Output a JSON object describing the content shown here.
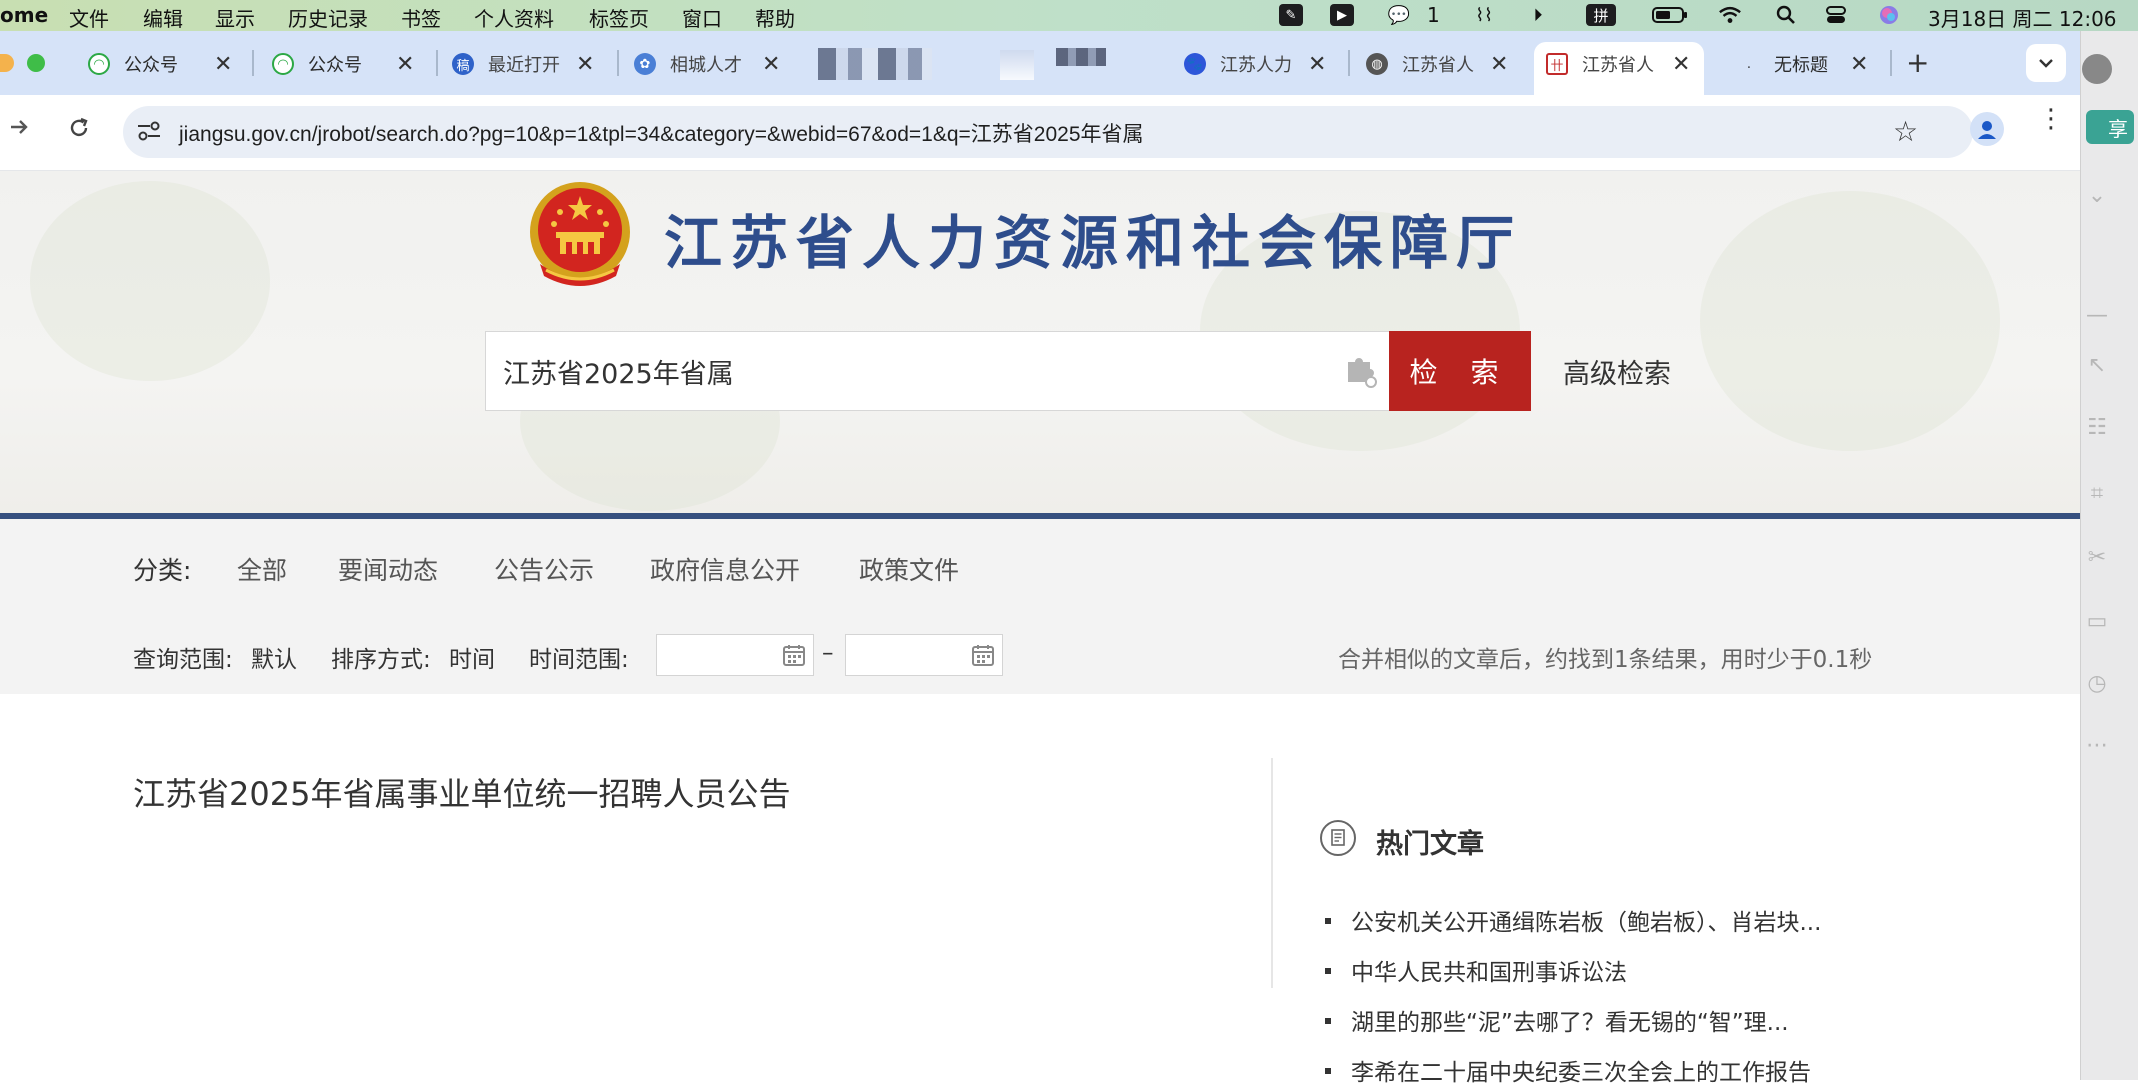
{
  "menubar": {
    "app_name": "ome",
    "items": [
      "文件",
      "编辑",
      "显示",
      "历史记录",
      "书签",
      "个人资料",
      "标签页",
      "窗口",
      "帮助"
    ],
    "wechat_count": "1",
    "ime_label": "拼",
    "datetime": "3月18日 周二  12:06"
  },
  "tabs": [
    {
      "title": "公众号",
      "icon": "wechat-mp-icon"
    },
    {
      "title": "公众号",
      "icon": "wechat-mp-icon"
    },
    {
      "title": "最近打开",
      "icon": "doc-app-icon"
    },
    {
      "title": "相城人才",
      "icon": "xiangcheng-icon"
    },
    {
      "title": "",
      "icon": "blurred-icon"
    },
    {
      "title": "",
      "icon": "blurred-icon"
    },
    {
      "title": "",
      "icon": "blurred-icon"
    },
    {
      "title": "江苏人力",
      "icon": "baidu-icon"
    },
    {
      "title": "江苏省人",
      "icon": "globe-icon"
    },
    {
      "title": "江苏省人",
      "icon": "jiangsu-gov-icon",
      "active": true
    },
    {
      "title": "无标题",
      "icon": "blank-icon"
    }
  ],
  "address": {
    "url": "jiangsu.gov.cn/jrobot/search.do?pg=10&p=1&tpl=34&category=&webid=67&od=1&q=江苏省2025年省属"
  },
  "header": {
    "site_title": "江苏省人力资源和社会保障厅",
    "search_value": "江苏省2025年省属",
    "search_button": "检 索",
    "advanced_search": "高级检索"
  },
  "filters": {
    "category_label": "分类:",
    "categories": [
      "全部",
      "要闻动态",
      "公告公示",
      "政府信息公开",
      "政策文件"
    ],
    "scope_label": "查询范围:",
    "scope_value": "默认",
    "sort_label": "排序方式:",
    "sort_value": "时间",
    "time_label": "时间范围:",
    "date_separator": "–",
    "result_summary": "合并相似的文章后，约找到1条结果，用时少于0.1秒"
  },
  "results": [
    {
      "title": "江苏省2025年省属事业单位统一招聘人员公告"
    }
  ],
  "hot": {
    "title": "热门文章",
    "items": [
      "公安机关公开通缉陈岩板（鲍岩板）、肖岩块...",
      "中华人民共和国刑事诉讼法",
      "湖里的那些“泥”去哪了？看无锡的“智”理...",
      "李希在二十届中央纪委三次全会上的工作报告"
    ]
  },
  "side_extension": {
    "badge": "享"
  },
  "colors": {
    "search_button": "#b8231f",
    "site_title": "#2e4d8c",
    "rule": "#36507f",
    "tabstrip": "#d6e3f8"
  }
}
